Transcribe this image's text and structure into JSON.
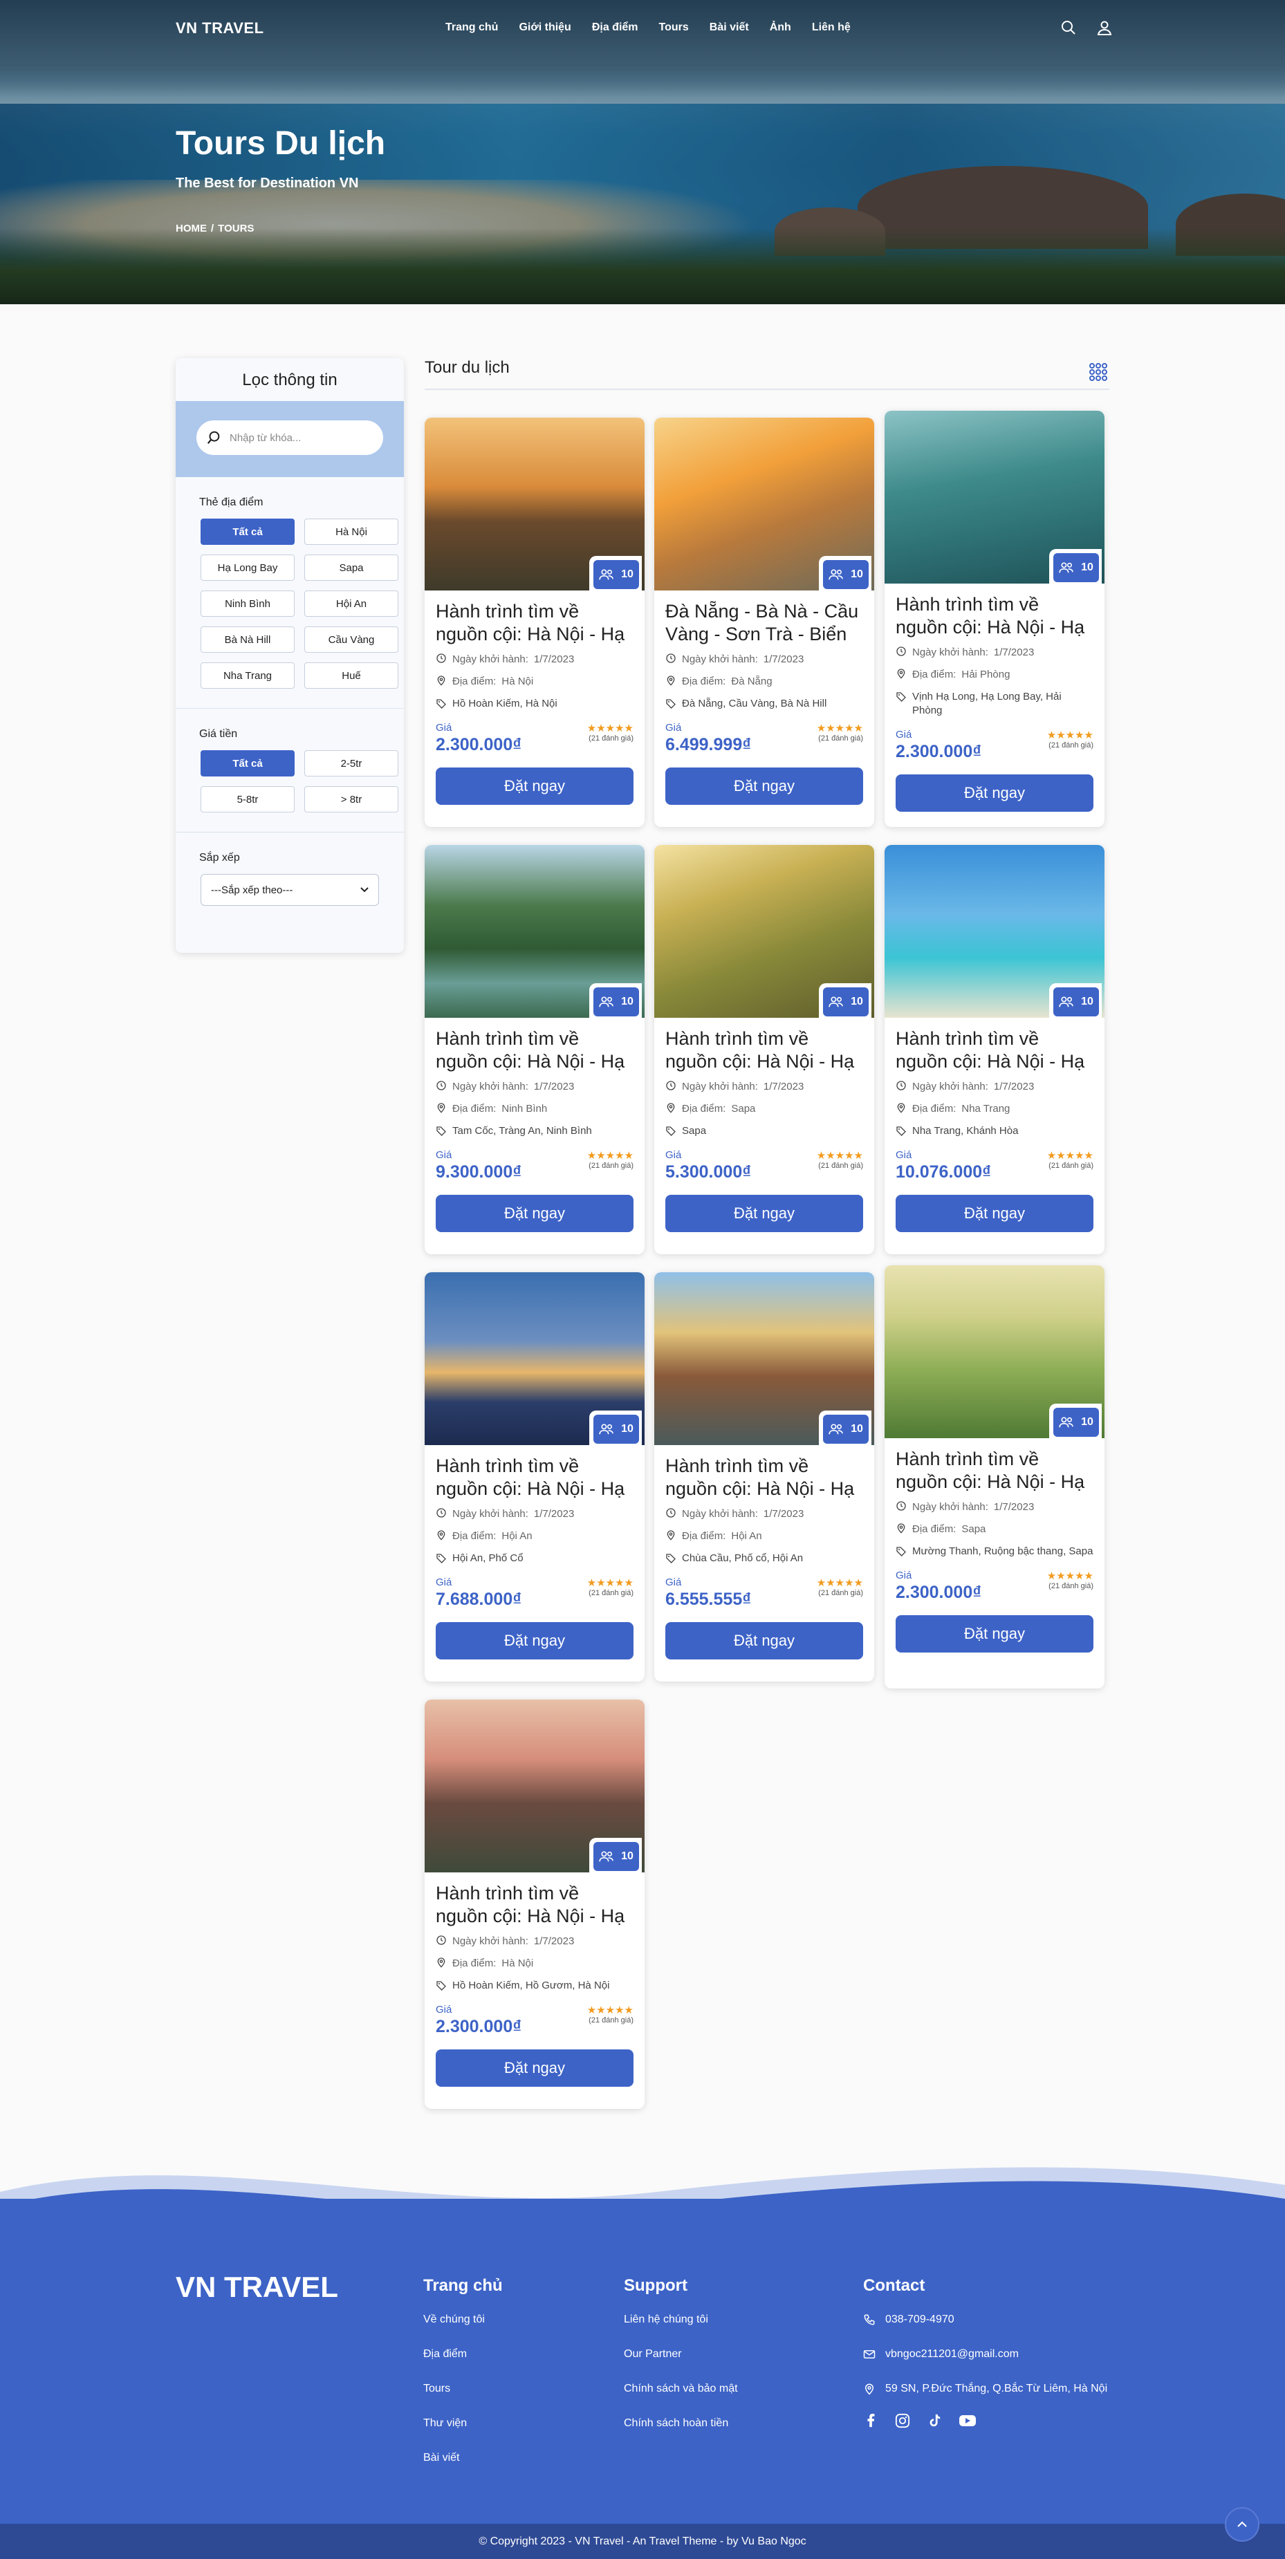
{
  "header": {
    "logo": "VN TRAVEL",
    "menu": [
      "Trang chủ",
      "Giới thiệu",
      "Địa điểm",
      "Tours",
      "Bài viết",
      "Ảnh",
      "Liên hệ"
    ]
  },
  "hero": {
    "title": "Tours Du lịch",
    "subtitle": "The Best for Destination VN",
    "breadcrumb": [
      "HOME",
      "/",
      "TOURS"
    ]
  },
  "sidebar": {
    "title": "Lọc thông tin",
    "search_placeholder": "Nhập từ khóa...",
    "location_label": "Thẻ địa điểm",
    "locations": [
      "Tất cả",
      "Hà Nội",
      "Hạ Long Bay",
      "Sapa",
      "Ninh Bình",
      "Hội An",
      "Bà Nà Hill",
      "Cầu Vàng",
      "Nha Trang",
      "Huế"
    ],
    "price_label": "Giá tiền",
    "prices": [
      "Tất cả",
      "2-5tr",
      "5-8tr",
      "> 8tr"
    ],
    "sort_label": "Sắp xếp",
    "sort_value": "---Sắp xếp theo---"
  },
  "main": {
    "title": "Tour du lịch",
    "labels": {
      "departure": "Ngày khởi hành:",
      "place": "Địa điểm:",
      "price": "Giá",
      "book": "Đặt ngay",
      "reviews": "(21 đánh giá)",
      "stars": "★★★★★"
    },
    "tours": [
      {
        "title": "Hành trình tìm về nguồn cội: Hà Nội - Hạ Long -...",
        "date": "1/7/2023",
        "place": "Hà Nội",
        "tags": "Hồ Hoàn Kiếm, Hà Nội",
        "price": "2.300.000₫",
        "people": "10"
      },
      {
        "title": "Đà Nẵng - Bà Nà - Cầu Vàng - Sơn Trà - Biển ...",
        "date": "1/7/2023",
        "place": "Đà Nẵng",
        "tags": "Đà Nẵng, Cầu Vàng, Bà Nà Hill",
        "price": "6.499.999₫",
        "people": "10"
      },
      {
        "title": "Hành trình tìm về nguồn cội: Hà Nội - Hạ Long -...",
        "date": "1/7/2023",
        "place": "Hải Phòng",
        "tags": "Vịnh Hạ Long, Hạ Long Bay, Hải Phòng",
        "price": "2.300.000₫",
        "people": "10"
      },
      {
        "title": "Hành trình tìm về nguồn cội: Hà Nội - Hạ Long -...",
        "date": "1/7/2023",
        "place": "Ninh Bình",
        "tags": "Tam Cốc, Tràng An, Ninh Bình",
        "price": "9.300.000₫",
        "people": "10"
      },
      {
        "title": "Hành trình tìm về nguồn cội: Hà Nội - Hạ Long -...",
        "date": "1/7/2023",
        "place": "Sapa",
        "tags": "Sapa",
        "price": "5.300.000₫",
        "people": "10"
      },
      {
        "title": "Hành trình tìm về nguồn cội: Hà Nội - Hạ Long -...",
        "date": "1/7/2023",
        "place": "Nha Trang",
        "tags": "Nha Trang, Khánh Hòa",
        "price": "10.076.000₫",
        "people": "10"
      },
      {
        "title": "Hành trình tìm về nguồn cội: Hà Nội - Hạ Long -...",
        "date": "1/7/2023",
        "place": "Hội An",
        "tags": "Hội An, Phố Cổ",
        "price": "7.688.000₫",
        "people": "10"
      },
      {
        "title": "Hành trình tìm về nguồn cội: Hà Nội - Hạ Long -...",
        "date": "1/7/2023",
        "place": "Hội An",
        "tags": "Chùa Cầu, Phố cổ, Hội An",
        "price": "6.555.555₫",
        "people": "10"
      },
      {
        "title": "Hành trình tìm về nguồn cội: Hà Nội - Hạ Long -...",
        "date": "1/7/2023",
        "place": "Sapa",
        "tags": "Mường Thanh, Ruộng bậc thang, Sapa",
        "price": "2.300.000₫",
        "people": "10"
      },
      {
        "title": "Hành trình tìm về nguồn cội: Hà Nội - Hạ Long -...",
        "date": "1/7/2023",
        "place": "Hà Nội",
        "tags": "Hồ Hoàn Kiếm, Hồ Gươm, Hà Nội",
        "price": "2.300.000₫",
        "people": "10"
      }
    ]
  },
  "footer": {
    "logo": "VN TRAVEL",
    "col1_title": "Trang chủ",
    "col1": [
      "Về chúng tôi",
      "Địa điểm",
      "Tours",
      "Thư viện",
      "Bài viết"
    ],
    "col2_title": "Support",
    "col2": [
      "Liên hệ chúng tôi",
      "Our Partner",
      "Chính sách và bảo mật",
      "Chính sách hoàn tiền"
    ],
    "col3_title": "Contact",
    "phone": "038-709-4970",
    "email": "vbngoc211201@gmail.com",
    "address": "59 SN, P.Đức Thắng, Q.Bắc Từ Liêm, Hà Nội",
    "copyright": "© Copyright 2023 - VN Travel - An Travel Theme - by Vu Bao Ngoc"
  },
  "colors": {
    "primary": "#3d63c7",
    "footer_bottom": "#2f4a95",
    "star": "#f29b1f"
  },
  "icons": [
    "search-icon",
    "user-icon",
    "grid-icon",
    "people-icon",
    "clock-icon",
    "location-icon",
    "tag-icon",
    "phone-icon",
    "mail-icon",
    "facebook-icon",
    "instagram-icon",
    "tiktok-icon",
    "youtube-icon",
    "arrow-up-icon"
  ]
}
